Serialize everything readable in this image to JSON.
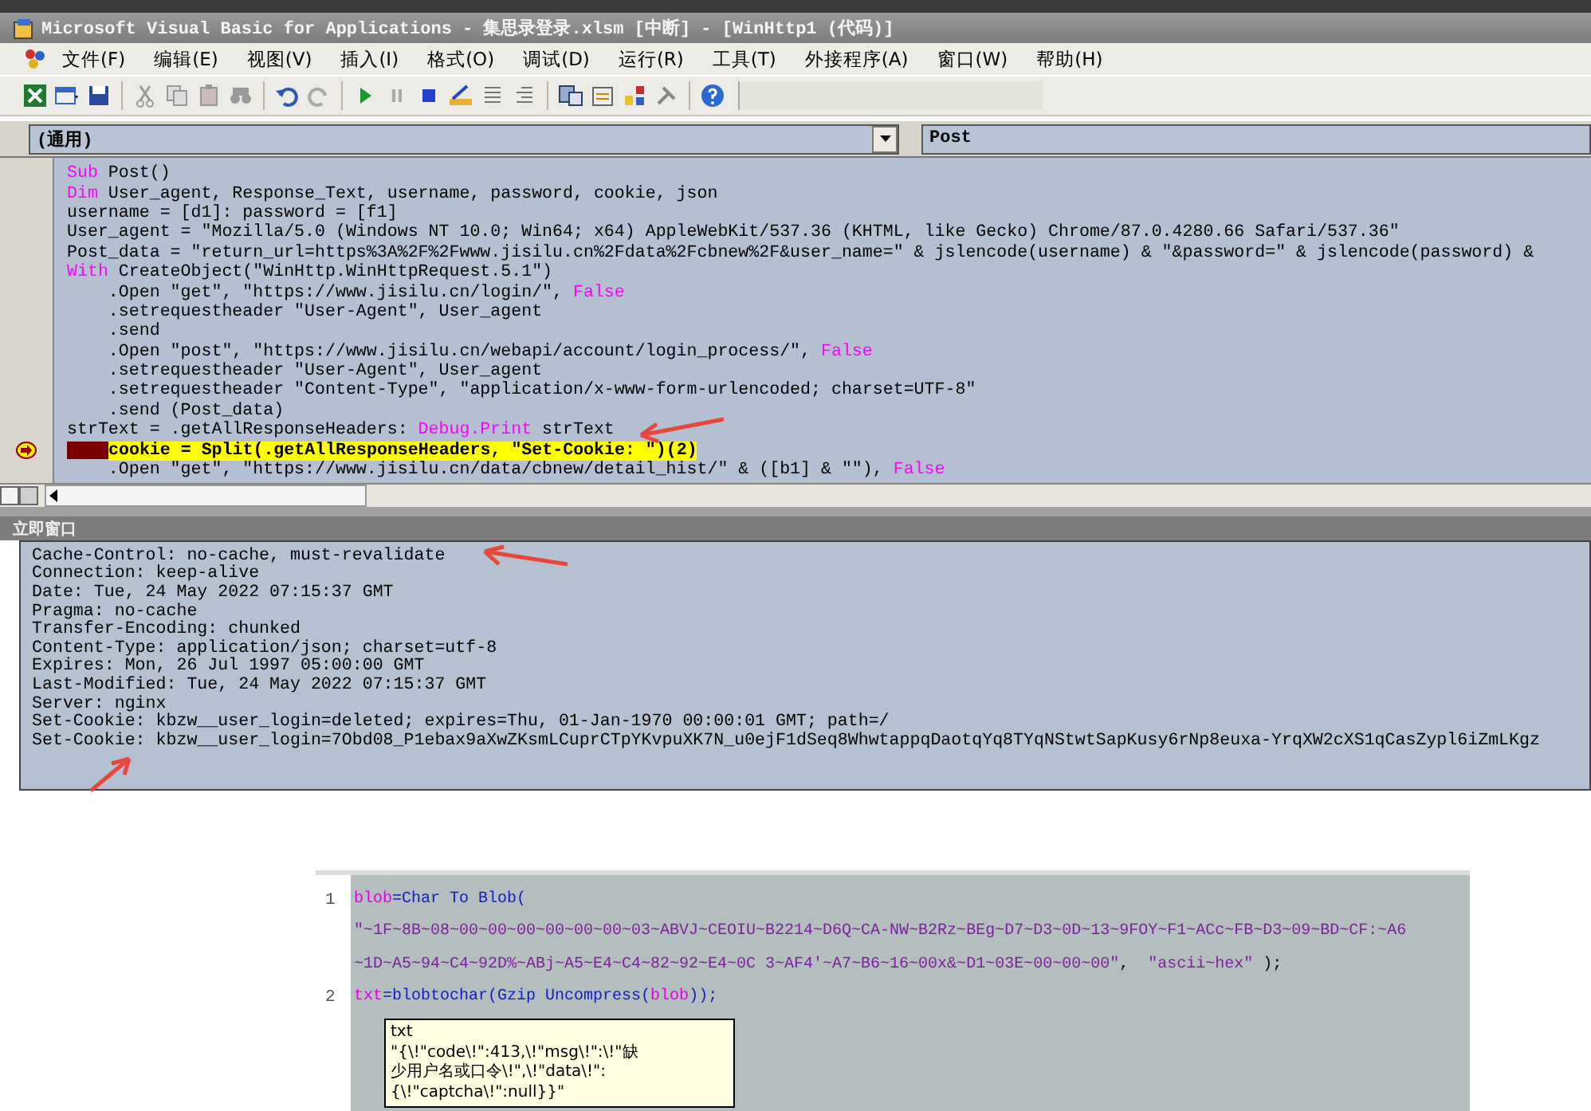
{
  "window": {
    "title": "Microsoft Visual Basic for Applications - 集思录登录.xlsm [中断] - [WinHttp1 (代码)]"
  },
  "menu": [
    "文件(F)",
    "编辑(E)",
    "视图(V)",
    "插入(I)",
    "格式(O)",
    "调试(D)",
    "运行(R)",
    "工具(T)",
    "外接程序(A)",
    "窗口(W)",
    "帮助(H)"
  ],
  "object_box": {
    "value": "(通用)"
  },
  "procedure_box": {
    "value": "Post"
  },
  "code": [
    {
      "current": false,
      "segments": [
        {
          "kind": "keyword",
          "text": "Sub"
        },
        {
          "kind": "plain",
          "text": " Post()"
        }
      ]
    },
    {
      "current": false,
      "segments": [
        {
          "kind": "keyword",
          "text": "Dim"
        },
        {
          "kind": "plain",
          "text": " User_agent, Response_Text, username, password, cookie, json"
        }
      ]
    },
    {
      "current": false,
      "segments": [
        {
          "kind": "plain",
          "text": "username = [d1]: password = [f1]"
        }
      ]
    },
    {
      "current": false,
      "segments": [
        {
          "kind": "plain",
          "text": "User_agent = \"Mozilla/5.0 (Windows NT 10.0; Win64; x64) AppleWebKit/537.36 (KHTML, like Gecko) Chrome/87.0.4280.66 Safari/537.36\""
        }
      ]
    },
    {
      "current": false,
      "segments": [
        {
          "kind": "plain",
          "text": "Post_data = \"return_url=https%3A%2F%2Fwww.jisilu.cn%2Fdata%2Fcbnew%2F&user_name=\" & jslencode(username) & \"&password=\" & jslencode(password) &"
        }
      ]
    },
    {
      "current": false,
      "segments": [
        {
          "kind": "keyword",
          "text": "With"
        },
        {
          "kind": "plain",
          "text": " CreateObject(\"WinHttp.WinHttpRequest.5.1\")"
        }
      ]
    },
    {
      "current": false,
      "segments": [
        {
          "kind": "plain",
          "text": "    .Open \"get\", \"https://www.jisilu.cn/login/\", "
        },
        {
          "kind": "keyword",
          "text": "False"
        }
      ]
    },
    {
      "current": false,
      "segments": [
        {
          "kind": "plain",
          "text": "    .setrequestheader \"User-Agent\", User_agent"
        }
      ]
    },
    {
      "current": false,
      "segments": [
        {
          "kind": "plain",
          "text": "    .send"
        }
      ]
    },
    {
      "current": false,
      "segments": [
        {
          "kind": "plain",
          "text": "    .Open \"post\", \"https://www.jisilu.cn/webapi/account/login_process/\", "
        },
        {
          "kind": "keyword",
          "text": "False"
        }
      ]
    },
    {
      "current": false,
      "segments": [
        {
          "kind": "plain",
          "text": "    .setrequestheader \"User-Agent\", User_agent"
        }
      ]
    },
    {
      "current": false,
      "segments": [
        {
          "kind": "plain",
          "text": "    .setrequestheader \"Content-Type\", \"application/x-www-form-urlencoded; charset=UTF-8\""
        }
      ]
    },
    {
      "current": false,
      "segments": [
        {
          "kind": "plain",
          "text": "    .send (Post_data)"
        }
      ]
    },
    {
      "current": false,
      "segments": [
        {
          "kind": "plain",
          "text": "strText = .getAllResponseHeaders: "
        },
        {
          "kind": "keyword",
          "text": "Debug.Print"
        },
        {
          "kind": "plain",
          "text": " strText"
        }
      ]
    },
    {
      "current": true,
      "segments": [
        {
          "kind": "plain",
          "text": "cookie = Split(.getAllResponseHeaders, \"Set-Cookie: \")(2)"
        }
      ]
    },
    {
      "current": false,
      "segments": [
        {
          "kind": "plain",
          "text": "    .Open \"get\", \"https://www.jisilu.cn/data/cbnew/detail_hist/\" & ([b1] & \"\"), "
        },
        {
          "kind": "keyword",
          "text": "False"
        }
      ]
    }
  ],
  "immediate": {
    "title": "立即窗口",
    "lines": [
      "Cache-Control: no-cache, must-revalidate",
      "Connection: keep-alive",
      "Date: Tue, 24 May 2022 07:15:37 GMT",
      "Pragma: no-cache",
      "Transfer-Encoding: chunked",
      "Content-Type: application/json; charset=utf-8",
      "Expires: Mon, 26 Jul 1997 05:00:00 GMT",
      "Last-Modified: Tue, 24 May 2022 07:15:37 GMT",
      "Server: nginx",
      "Set-Cookie: kbzw__user_login=deleted; expires=Thu, 01-Jan-1970 00:00:01 GMT; path=/",
      "Set-Cookie: kbzw__user_login=7Obd08_P1ebax9aXwZKsmLCuprCTpYKvpuXK7N_u0ejF1dSeq8WhwtappqDaotqYq8TYqNStwtSapKusy6rNp8euxa-YrqXW2cXS1qCasZypl6iZmLKgz"
    ]
  },
  "snippet": {
    "lines": [
      {
        "number": "1",
        "rows": [
          {
            "spans": [
              {
                "kind": "var",
                "text": "blob"
              },
              {
                "kind": "func",
                "text": "=Char To Blob("
              }
            ]
          },
          {
            "spans": [
              {
                "kind": "string",
                "text": "\"~1F~8B~08~00~00~00~00~00~00~03~ABVJ~CEOIU~B2214~D6Q~CA-NW~B2Rz~BEg~D7~D3~0D~13~9FOY~F1~ACc~FB~D3~09~BD~CF:~A6"
              }
            ]
          },
          {
            "spans": [
              {
                "kind": "string",
                "text": "~1D~A5~94~C4~92D%~ABj~A5~E4~C4~82~92~E4~0C 3~AF4'~A7~B6~16~00x&~D1~03E~00~00~00\""
              },
              {
                "kind": "plain",
                "text": ",  "
              },
              {
                "kind": "string",
                "text": "\"ascii~hex\""
              },
              {
                "kind": "plain",
                "text": " );"
              }
            ]
          }
        ]
      },
      {
        "number": "2",
        "rows": [
          {
            "spans": [
              {
                "kind": "var",
                "text": "txt"
              },
              {
                "kind": "func",
                "text": "=blobtochar(Gzip Uncompress("
              },
              {
                "kind": "var",
                "text": "blob"
              },
              {
                "kind": "func",
                "text": "));"
              }
            ]
          }
        ]
      }
    ],
    "tooltip": {
      "name": "txt",
      "lines": [
        "\"{\\!\"code\\!\":413,\\!\"msg\\!\":\\!\"缺",
        "少用户名或口令\\!\",\\!\"data\\!\":",
        "{\\!\"captcha\\!\":null}}\""
      ]
    }
  }
}
